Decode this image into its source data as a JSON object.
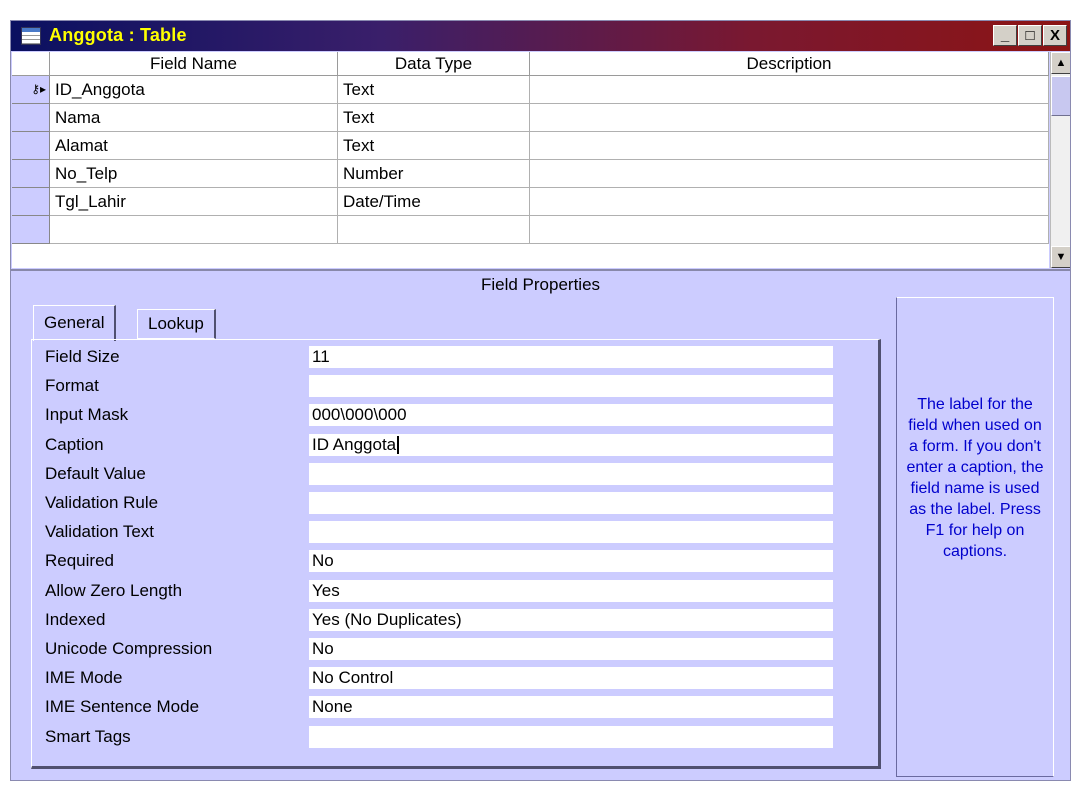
{
  "window": {
    "title": "Anggota : Table",
    "buttons": {
      "minimize": "_",
      "maximize": "□",
      "close": "X"
    }
  },
  "grid": {
    "headers": [
      "Field Name",
      "Data Type",
      "Description"
    ],
    "rows": [
      {
        "field": "ID_Anggota",
        "type": "Text",
        "description": "",
        "primary_key": true
      },
      {
        "field": "Nama",
        "type": "Text",
        "description": ""
      },
      {
        "field": "Alamat",
        "type": "Text",
        "description": ""
      },
      {
        "field": "No_Telp",
        "type": "Number",
        "description": ""
      },
      {
        "field": "Tgl_Lahir",
        "type": "Date/Time",
        "description": ""
      },
      {
        "field": "",
        "type": "",
        "description": ""
      }
    ]
  },
  "field_properties": {
    "section_title": "Field Properties",
    "tabs": [
      "General",
      "Lookup"
    ],
    "active_tab": "General",
    "properties": [
      {
        "label": "Field Size",
        "value": "11"
      },
      {
        "label": "Format",
        "value": ""
      },
      {
        "label": "Input Mask",
        "value": "000\\000\\000"
      },
      {
        "label": "Caption",
        "value": "ID Anggota"
      },
      {
        "label": "Default Value",
        "value": ""
      },
      {
        "label": "Validation Rule",
        "value": ""
      },
      {
        "label": "Validation Text",
        "value": ""
      },
      {
        "label": "Required",
        "value": "No"
      },
      {
        "label": "Allow Zero Length",
        "value": "Yes"
      },
      {
        "label": "Indexed",
        "value": "Yes (No Duplicates)"
      },
      {
        "label": "Unicode Compression",
        "value": "No"
      },
      {
        "label": "IME Mode",
        "value": "No Control"
      },
      {
        "label": "IME Sentence Mode",
        "value": "None"
      },
      {
        "label": "Smart Tags",
        "value": ""
      }
    ],
    "help_text": "The label for the field when used on a form.  If you don't enter a caption, the field name is used as the label.  Press F1 for help on captions."
  },
  "colors": {
    "window_bg": "#ccccff",
    "title_text": "#ffff00",
    "help_text": "#0000cc"
  }
}
